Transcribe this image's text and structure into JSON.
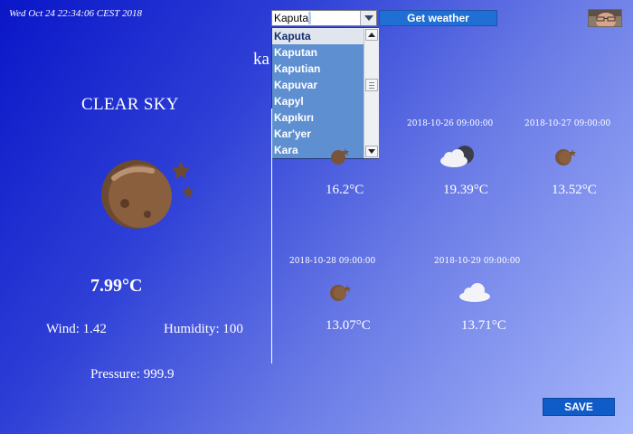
{
  "header": {
    "datetime": "Wed Oct 24 22:34:06 CEST 2018",
    "search": {
      "value": "Kaputa",
      "button_label": "Get weather",
      "suggestions": [
        "Kaputa",
        "Kaputan",
        "Kaputian",
        "Kapuvar",
        "Kapyl",
        "Kapıkırı",
        "Kar'yer",
        "Kara"
      ],
      "selected_index": 0
    },
    "avatar_icon": "user-photo"
  },
  "typed_text": "ka",
  "current": {
    "condition": "CLEAR SKY",
    "icon": "moon-stars-icon",
    "temperature": "7.99°C",
    "wind": "Wind: 1.42",
    "humidity": "Humidity: 100",
    "pressure": "Pressure: 999.9"
  },
  "forecast": [
    {
      "date": "",
      "icon": "moon-icon",
      "temp": "16.2°C"
    },
    {
      "date": "2018-10-26 09:00:00",
      "icon": "cloud-moon-icon",
      "temp": "19.39°C"
    },
    {
      "date": "2018-10-27 09:00:00",
      "icon": "moon-icon",
      "temp": "13.52°C"
    },
    {
      "date": "2018-10-28 09:00:00",
      "icon": "moon-icon",
      "temp": "13.07°C"
    },
    {
      "date": "2018-10-29 09:00:00",
      "icon": "cloud-icon",
      "temp": "13.71°C"
    }
  ],
  "actions": {
    "save_label": "SAVE"
  },
  "colors": {
    "bg_start": "#0a16c8",
    "bg_end": "#a8b8fb",
    "button": "#1f6fd4",
    "dropdown": "#5e8fd0",
    "moon": "#6b4a32"
  }
}
